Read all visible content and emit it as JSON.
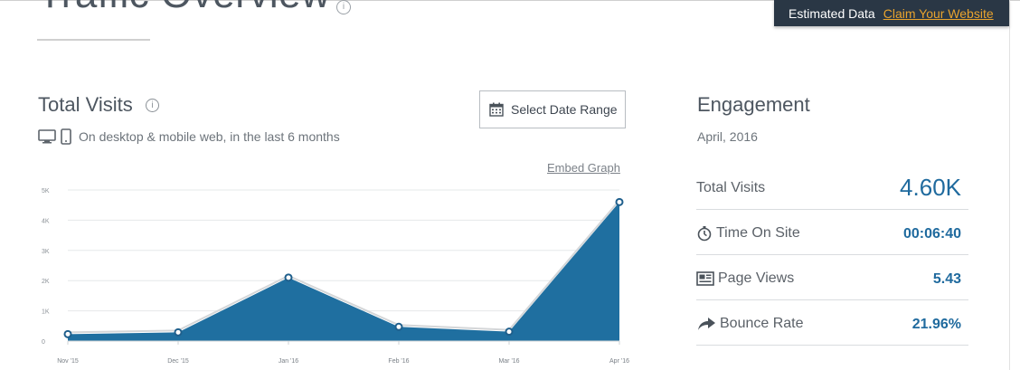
{
  "page": {
    "title": "Traffic Overview",
    "title_info": "i"
  },
  "banner": {
    "text": "Estimated Data",
    "claim_link": "Claim Your Website",
    "bg_color": "#2a3745",
    "link_color": "#e8a32e"
  },
  "total_visits": {
    "title": "Total Visits",
    "info": "i",
    "subtitle": "On desktop & mobile web, in the last 6 months",
    "date_button": "Select Date Range",
    "embed_link": "Embed Graph",
    "icons": [
      "desktop-icon",
      "mobile-icon",
      "calendar-icon",
      "info-icon"
    ]
  },
  "chart_data": {
    "type": "area",
    "title": "",
    "xlabel": "",
    "ylabel": "",
    "categories": [
      "Nov '15",
      "Dec '15",
      "Jan '16",
      "Feb '16",
      "Mar '16",
      "Apr '16"
    ],
    "y_ticks": [
      "0",
      "1K",
      "2K",
      "3K",
      "4K",
      "5K"
    ],
    "ylim": [
      0,
      5000
    ],
    "grid": true,
    "series": [
      {
        "values": [
          230,
          290,
          2100,
          470,
          310,
          4600
        ],
        "color": "#1f6fa0"
      }
    ]
  },
  "engagement": {
    "title": "Engagement",
    "date": "April, 2016",
    "rows": [
      {
        "label": "Total Visits",
        "value": "4.60K",
        "icon": ""
      },
      {
        "label": "Time On Site",
        "value": "00:06:40",
        "icon": "stopwatch-icon"
      },
      {
        "label": "Page Views",
        "value": "5.43",
        "icon": "page-views-icon"
      },
      {
        "label": "Bounce Rate",
        "value": "21.96%",
        "icon": "bounce-arrow-icon"
      }
    ],
    "value_color": "#1f6a9e"
  }
}
